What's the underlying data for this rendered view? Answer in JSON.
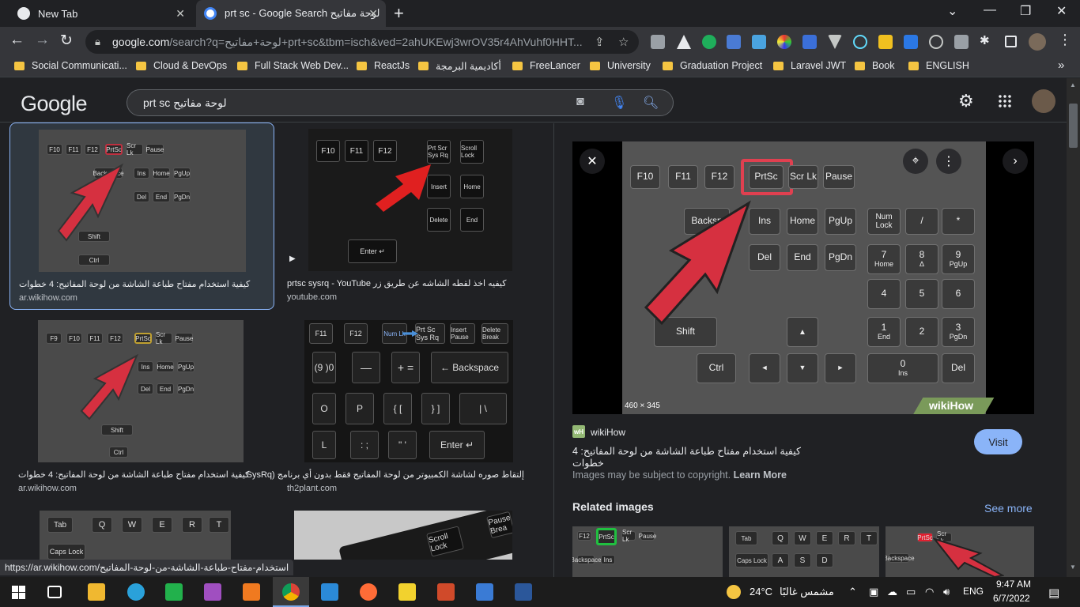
{
  "tabs": [
    {
      "title": "New Tab",
      "close": "✕"
    },
    {
      "title": "prt sc - Google Search لوحة مفاتيح",
      "close": "✕"
    }
  ],
  "new_tab": "+",
  "window_controls": {
    "minimize": "⌄",
    "restore": "❐",
    "close": "✕",
    "tab_search": "⌄"
  },
  "toolbar": {
    "back": "←",
    "forward": "→",
    "reload": "↻",
    "url_host": "google.com",
    "url_path": "/search?q=لوحة+مفاتيح+prt+sc&tbm=isch&ved=2ahUKEwj3wrOV35r4AhVuhf0HHT...",
    "share_icon": "⇪",
    "star_icon": "☆"
  },
  "bookmarks": [
    "Social Communicati...",
    "Cloud & DevOps",
    "Full Stack Web Dev...",
    "ReactJs",
    "أكاديمية البرمجة",
    "FreeLancer",
    "University",
    "Graduation Project",
    "Laravel JWT",
    "Book",
    "ENGLISH"
  ],
  "bookmarks_more": "»",
  "google": {
    "logo": "Google",
    "query": "prt sc لوحة مفاتيح",
    "settings_icon": "⚙",
    "apps_icon": "⋮⋮⋮"
  },
  "results": [
    {
      "caption": "كيفية استخدام مفتاح طباعة الشاشة من لوحة المفاتيح: 4 خطوات",
      "source": "ar.wikihow.com"
    },
    {
      "caption": "كيفيه اخذ لقطه الشاشه عن طريق زر prtsc sysrq - YouTube",
      "source": "youtube.com"
    },
    {
      "caption": "كيفية استخدام مفتاح طباعة الشاشة من لوحة المفاتيح: 4 خطوات",
      "source": "ar.wikihow.com"
    },
    {
      "caption": "إلتقاط صوره لشاشة الكمبيوتر من لوحة المفاتيح فقط بدون أي برنامج (SysRq...",
      "source": "th2plant.com"
    }
  ],
  "preview": {
    "size_label": "460 × 345",
    "watermark": "wikiHow",
    "site_name": "wikiHow",
    "title": "كيفية استخدام مفتاح طباعة الشاشة من لوحة المفاتيح: 4 خطوات",
    "visit": "Visit",
    "copyright": "Images may be subject to copyright.",
    "learn_more": "Learn More",
    "related": "Related images",
    "see_more": "See more",
    "close_icon": "✕",
    "more_icon": "⋮",
    "next_icon": "›",
    "keys_row1": [
      "F10",
      "F11",
      "F12",
      "PrtSc",
      "Scr Lk",
      "Pause"
    ],
    "key_backsp": "Backsp",
    "key_ins": "Ins",
    "key_home": "Home",
    "key_pgup": "PgUp",
    "key_del": "Del",
    "key_end": "End",
    "key_pgdn": "PgDn",
    "key_numlock": "Num Lock",
    "key_slash": "/",
    "key_star": "*",
    "key_7": "7",
    "key_7s": "Home",
    "key_8": "8",
    "key_8s": "∆",
    "key_9": "9",
    "key_9s": "PgUp",
    "key_4": "4",
    "key_5": "5",
    "key_6": "6",
    "key_shift": "Shift",
    "key_up": "▲",
    "key_1": "1",
    "key_1s": "End",
    "key_2": "2",
    "key_3": "3",
    "key_3s": "PgDn",
    "key_ctrl": "Ctrl",
    "key_left": "◄",
    "key_down": "▼",
    "key_right": "►",
    "key_0": "0",
    "key_0s": "Ins",
    "key_dot": "Del"
  },
  "status_url": "https://ar.wikihow.com/استخدام-مفتاح-طباعة-الشاشة-من-لوحة-المفاتيح",
  "taskbar": {
    "weather": "24°C",
    "weather_text": "مشمس غالبًا",
    "lang": "ENG",
    "time": "9:47 AM",
    "date": "6/7/2022"
  },
  "colors": {
    "accent": "#8ab4f8",
    "arrow_red": "#d63040",
    "highlight": "#e04050",
    "folder": "#f5c542"
  }
}
